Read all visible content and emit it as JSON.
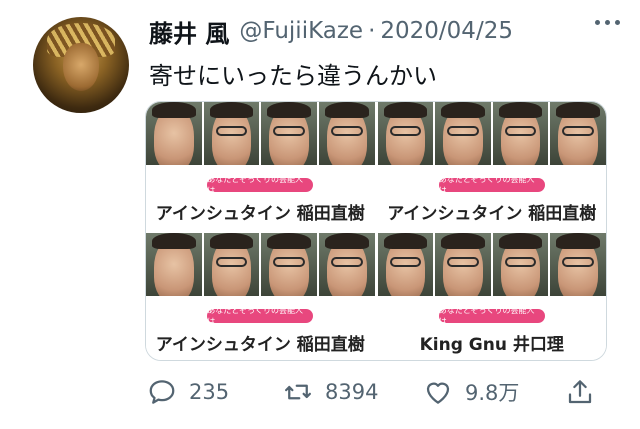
{
  "tweet": {
    "display_name": "藤井 風",
    "handle": "@FujiiKaze",
    "separator": "·",
    "date": "2020/04/25",
    "text": "寄せにいったら違うんかい"
  },
  "media": {
    "cards": [
      {
        "pill": "あなたとそっくりの芸能人は…",
        "match": "アインシュタイン 稲田直樹"
      },
      {
        "pill": "あなたとそっくりの芸能人は…",
        "match": "アインシュタイン 稲田直樹"
      },
      {
        "pill": "あなたとそっくりの芸能人は…",
        "match": "アインシュタイン 稲田直樹"
      },
      {
        "pill": "あなたとそっくりの芸能人は…",
        "match": "King Gnu 井口理"
      }
    ]
  },
  "actions": {
    "reply_count": "235",
    "retweet_count": "8394",
    "like_count": "9.8万"
  },
  "icons": {
    "reply": "reply-icon",
    "retweet": "retweet-icon",
    "like": "heart-icon",
    "share": "share-icon",
    "more": "more-dots-icon"
  },
  "colors": {
    "text": "#0f1419",
    "secondary": "#536471",
    "pill": "#e8477e"
  }
}
